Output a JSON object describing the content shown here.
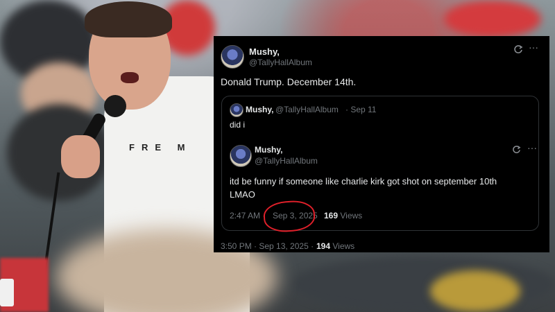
{
  "tweet": {
    "author_name": "Mushy,",
    "author_handle": "@TallyHallAlbum",
    "text": "Donald Trump. December 14th.",
    "timestamp": "3:50 PM · Sep 13, 2025 ·",
    "views_count": "194",
    "views_label": "Views",
    "icons": [
      "refresh-icon",
      "more-icon"
    ]
  },
  "quoted": {
    "author_name": "Mushy,",
    "author_handle": "@TallyHallAlbum",
    "date": "· Sep 11",
    "text": "did i",
    "nested": {
      "author_name": "Mushy,",
      "author_handle": "@TallyHallAlbum",
      "text_line1": "itd be funny if someone like charlie kirk got shot on september 10th",
      "text_line2": "LMAO",
      "time": "2:47 AM ·",
      "date": "Sep 3, 2025",
      "views_count": "169",
      "views_label": "Views"
    }
  },
  "photo": {
    "shirt_text": "FRE M"
  },
  "colors": {
    "card_bg": "#000000",
    "text": "#e7e9ea",
    "muted": "#71767b",
    "annotation": "#e0202a"
  }
}
